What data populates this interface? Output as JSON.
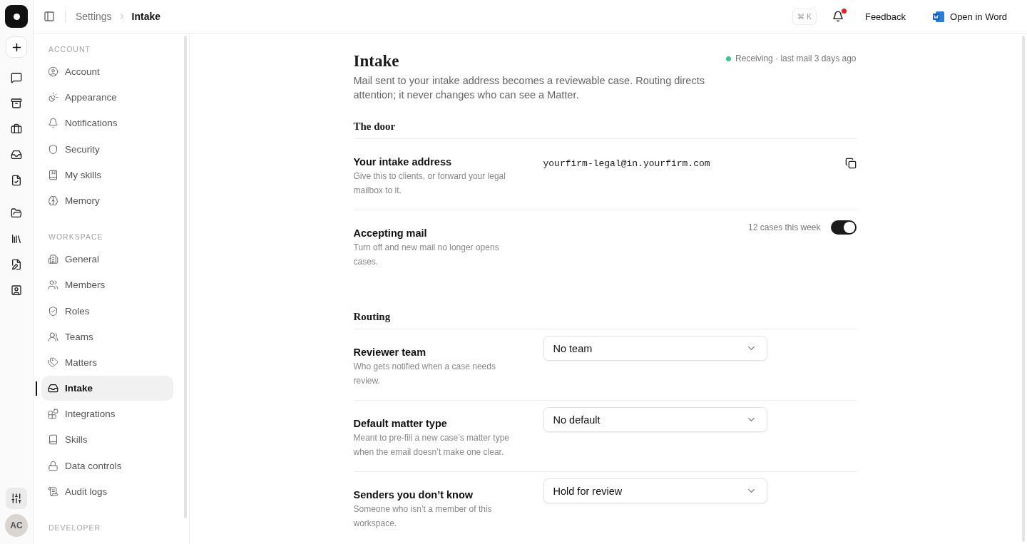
{
  "rail": {
    "settings": {
      "selected": true
    },
    "avatar": "AC"
  },
  "topbar": {
    "breadcrumb": [
      "Settings",
      "Intake"
    ],
    "shortcut": "⌘ K",
    "notifications": {
      "unread": true
    },
    "feedback": "Feedback",
    "open_in_word": "Open in Word"
  },
  "sidebar": {
    "sections": [
      {
        "heading": "ACCOUNT",
        "items": [
          {
            "label": "Account",
            "selected": false
          },
          {
            "label": "Appearance",
            "selected": false
          },
          {
            "label": "Notifications",
            "selected": false
          },
          {
            "label": "Security",
            "selected": false
          },
          {
            "label": "My skills",
            "selected": false
          },
          {
            "label": "Memory",
            "selected": false
          }
        ]
      },
      {
        "heading": "WORKSPACE",
        "items": [
          {
            "label": "General",
            "selected": false
          },
          {
            "label": "Members",
            "selected": false
          },
          {
            "label": "Roles",
            "selected": false
          },
          {
            "label": "Teams",
            "selected": false
          },
          {
            "label": "Matters",
            "selected": false
          },
          {
            "label": "Intake",
            "selected": true
          },
          {
            "label": "Integrations",
            "selected": false
          },
          {
            "label": "Skills",
            "selected": false
          },
          {
            "label": "Data controls",
            "selected": false
          },
          {
            "label": "Audit logs",
            "selected": false
          }
        ]
      },
      {
        "heading": "DEVELOPER"
      }
    ]
  },
  "page": {
    "title": "Intake",
    "description": "Mail sent to your intake address becomes a reviewable case. Routing directs attention; it never changes who can see a Matter.",
    "status": "Receiving · last mail 3 days ago",
    "sections": [
      {
        "heading": "The door",
        "rows": [
          {
            "kind": "address",
            "label": "Your intake address",
            "hint": "Give this to clients, or forward your legal mailbox to it.",
            "value": "yourfirm-legal@in.yourfirm.com"
          },
          {
            "kind": "toggle",
            "label": "Accepting mail",
            "hint": "Turn off and new mail no longer opens cases.",
            "note": "12 cases this week",
            "on": true
          }
        ]
      },
      {
        "heading": "Routing",
        "rows": [
          {
            "kind": "select",
            "label": "Reviewer team",
            "hint": "Who gets notified when a case needs review.",
            "value": "No team"
          },
          {
            "kind": "select",
            "label": "Default matter type",
            "hint": "Meant to pre-fill a new case’s matter type when the email doesn’t make one clear.",
            "value": "No default"
          },
          {
            "kind": "select",
            "label": "Senders you don’t know",
            "hint": "Someone who isn’t a member of this workspace.",
            "value": "Hold for review"
          }
        ]
      }
    ]
  }
}
